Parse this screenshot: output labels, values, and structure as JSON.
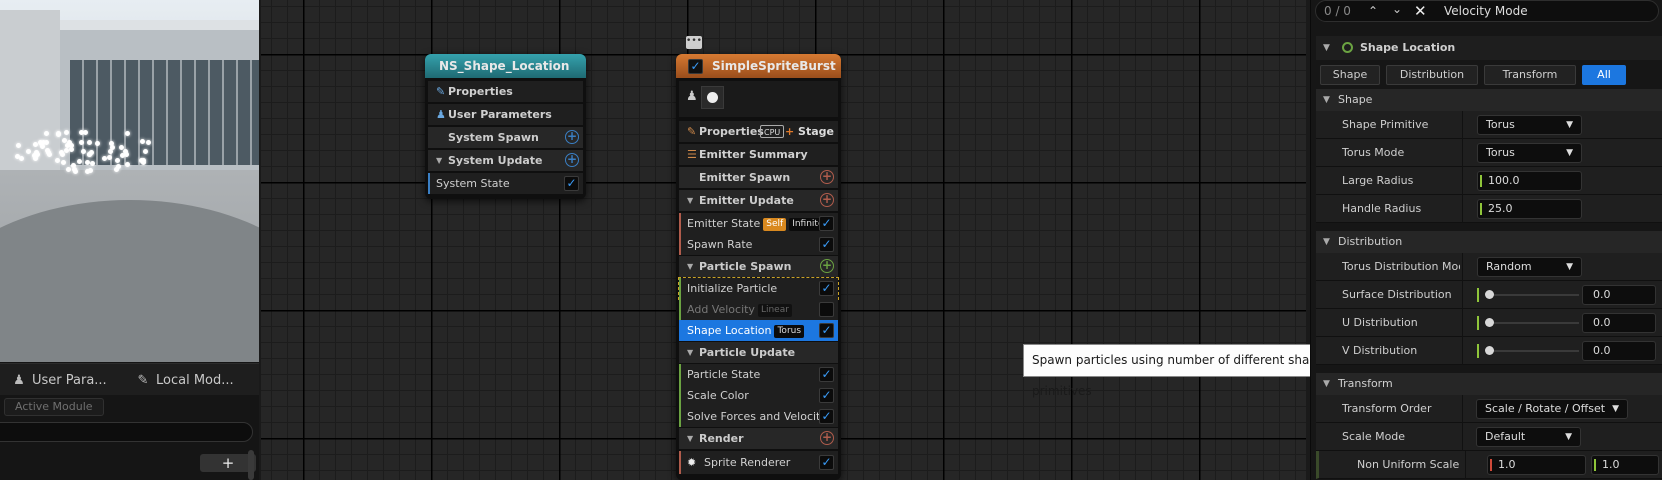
{
  "left_panel": {
    "tabs": [
      {
        "label": "User Para...",
        "icon": "user-icon"
      },
      {
        "label": "Local Mod...",
        "icon": "module-icon"
      }
    ],
    "active_module_label": "Active Module",
    "add_label": "+"
  },
  "nodes": {
    "system": {
      "title": "NS_Shape_Location",
      "header_color": "#2e8a94",
      "rows": {
        "properties": "Properties",
        "user_parameters": "User Parameters",
        "system_spawn": "System Spawn",
        "system_update": "System Update",
        "system_state": "System State"
      }
    },
    "emitter": {
      "title": "SimpleSpriteBurst",
      "header_color": "#c06a2a",
      "properties": "Properties",
      "cpu_label": "CPU",
      "stage_label": "Stage",
      "emitter_summary": "Emitter Summary",
      "emitter_spawn": "Emitter Spawn",
      "emitter_update": "Emitter Update",
      "emitter_state": "Emitter State",
      "badge_self": "Self",
      "badge_infinite": "Infinite",
      "spawn_rate": "Spawn Rate",
      "particle_spawn": "Particle Spawn",
      "initialize_particle": "Initialize Particle",
      "add_velocity": "Add Velocity",
      "badge_linear": "Linear",
      "shape_location": "Shape Location",
      "badge_torus": "Torus",
      "particle_update": "Particle Update",
      "particle_state": "Particle State",
      "scale_color": "Scale Color",
      "solve_forces": "Solve Forces and Velocity",
      "render": "Render",
      "sprite_renderer": "Sprite Renderer"
    }
  },
  "tooltip": "Spawn particles using number of different shape primitives",
  "details": {
    "search": {
      "count": "0 / 0",
      "text": "Velocity Mode"
    },
    "module_title": "Shape Location",
    "filter_tabs": [
      "Shape",
      "Distribution",
      "Transform",
      "All"
    ],
    "active_filter": "All",
    "categories": {
      "shape": "Shape",
      "distribution": "Distribution",
      "transform": "Transform"
    },
    "props": {
      "shape_primitive": {
        "label": "Shape Primitive",
        "value": "Torus"
      },
      "torus_mode": {
        "label": "Torus Mode",
        "value": "Torus"
      },
      "large_radius": {
        "label": "Large Radius",
        "value": "100.0"
      },
      "handle_radius": {
        "label": "Handle Radius",
        "value": "25.0"
      },
      "torus_distribution_mode": {
        "label": "Torus Distribution Mode",
        "value": "Random"
      },
      "surface_distribution": {
        "label": "Surface Distribution",
        "value": "0.0",
        "fraction": 0
      },
      "u_distribution": {
        "label": "U Distribution",
        "value": "0.0",
        "fraction": 0
      },
      "v_distribution": {
        "label": "V Distribution",
        "value": "0.0",
        "fraction": 0
      },
      "transform_order": {
        "label": "Transform Order",
        "value": "Scale / Rotate / Offset"
      },
      "scale_mode": {
        "label": "Scale Mode",
        "value": "Default"
      },
      "non_uniform_scale": {
        "label": "Non Uniform Scale",
        "x": "1.0",
        "y": "1.0"
      }
    },
    "accent": "#1c77e0"
  }
}
